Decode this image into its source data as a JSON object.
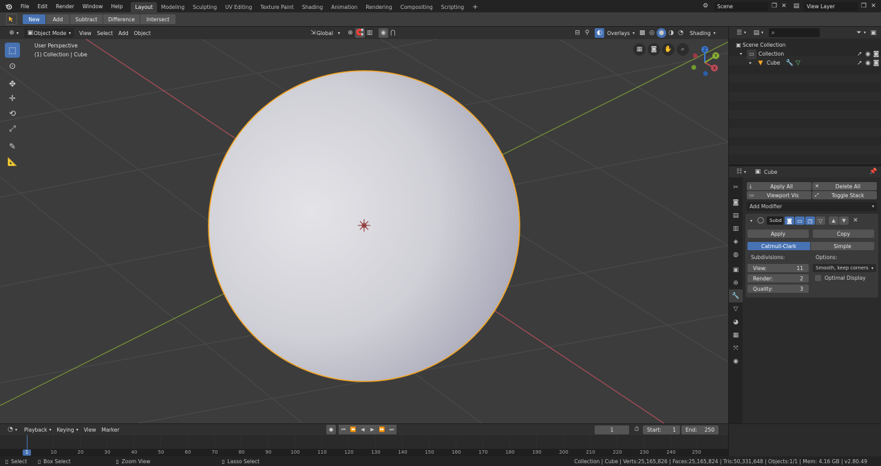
{
  "topbar": {
    "menus": [
      "File",
      "Edit",
      "Render",
      "Window",
      "Help"
    ],
    "workspaces": [
      "Layout",
      "Modeling",
      "Sculpting",
      "UV Editing",
      "Texture Paint",
      "Shading",
      "Animation",
      "Rendering",
      "Compositing",
      "Scripting"
    ],
    "active_workspace": "Layout",
    "add_tab": "+",
    "scene": "Scene",
    "view_layer": "View Layer"
  },
  "tool_settings": {
    "modes": [
      "New",
      "Add",
      "Subtract",
      "Difference",
      "Intersect"
    ],
    "active_mode": "New"
  },
  "viewport_header": {
    "mode": "Object Mode",
    "menus": [
      "View",
      "Select",
      "Add",
      "Object"
    ],
    "orientation": "Global",
    "overlays": "Overlays",
    "shading": "Shading"
  },
  "viewport": {
    "perspective": "User Perspective",
    "collection_info": "(1) Collection | Cube",
    "gizmo": {
      "z": "Z",
      "y": "Y",
      "x": "X"
    }
  },
  "outliner": {
    "scene_collection": "Scene Collection",
    "collection": "Collection",
    "object": "Cube"
  },
  "properties": {
    "object_name": "Cube",
    "apply_all": "Apply All",
    "delete_all": "Delete All",
    "viewport_vis": "Viewport Vis",
    "toggle_stack": "Toggle Stack",
    "add_modifier": "Add Modifier",
    "modifier_name": "Subd",
    "apply": "Apply",
    "copy": "Copy",
    "algorithms": [
      "Catmull-Clark",
      "Simple"
    ],
    "active_algorithm": "Catmull-Clark",
    "subdivisions_label": "Subdivisions:",
    "options_label": "Options:",
    "view_label": "View:",
    "view_value": "11",
    "render_label": "Render:",
    "render_value": "2",
    "quality_label": "Quality:",
    "quality_value": "3",
    "uv_smooth": "Smooth, keep corners",
    "optimal_display": "Optimal Display"
  },
  "timeline": {
    "menus": [
      "Playback",
      "Keying",
      "View",
      "Marker"
    ],
    "current_frame": "1",
    "start_label": "Start:",
    "start_value": "1",
    "end_label": "End:",
    "end_value": "250",
    "ticks": [
      "1",
      "10",
      "20",
      "30",
      "40",
      "50",
      "60",
      "70",
      "80",
      "90",
      "100",
      "110",
      "120",
      "130",
      "140",
      "150",
      "160",
      "170",
      "180",
      "190",
      "200",
      "210",
      "220",
      "230",
      "240",
      "250"
    ]
  },
  "statusbar": {
    "select": "Select",
    "box_select": "Box Select",
    "zoom_view": "Zoom View",
    "lasso_select": "Lasso Select",
    "stats": "Collection | Cube | Verts:25,165,826 | Faces:25,165,824 | Tris:50,331,648 | Objects:1/1 | Mem: 4.16 GB | v2.80.49"
  },
  "colors": {
    "accent": "#4772b3",
    "selection": "#f5a623",
    "x_axis": "#c04c58",
    "y_axis": "#8ab036",
    "z_axis": "#3b7ad6"
  }
}
